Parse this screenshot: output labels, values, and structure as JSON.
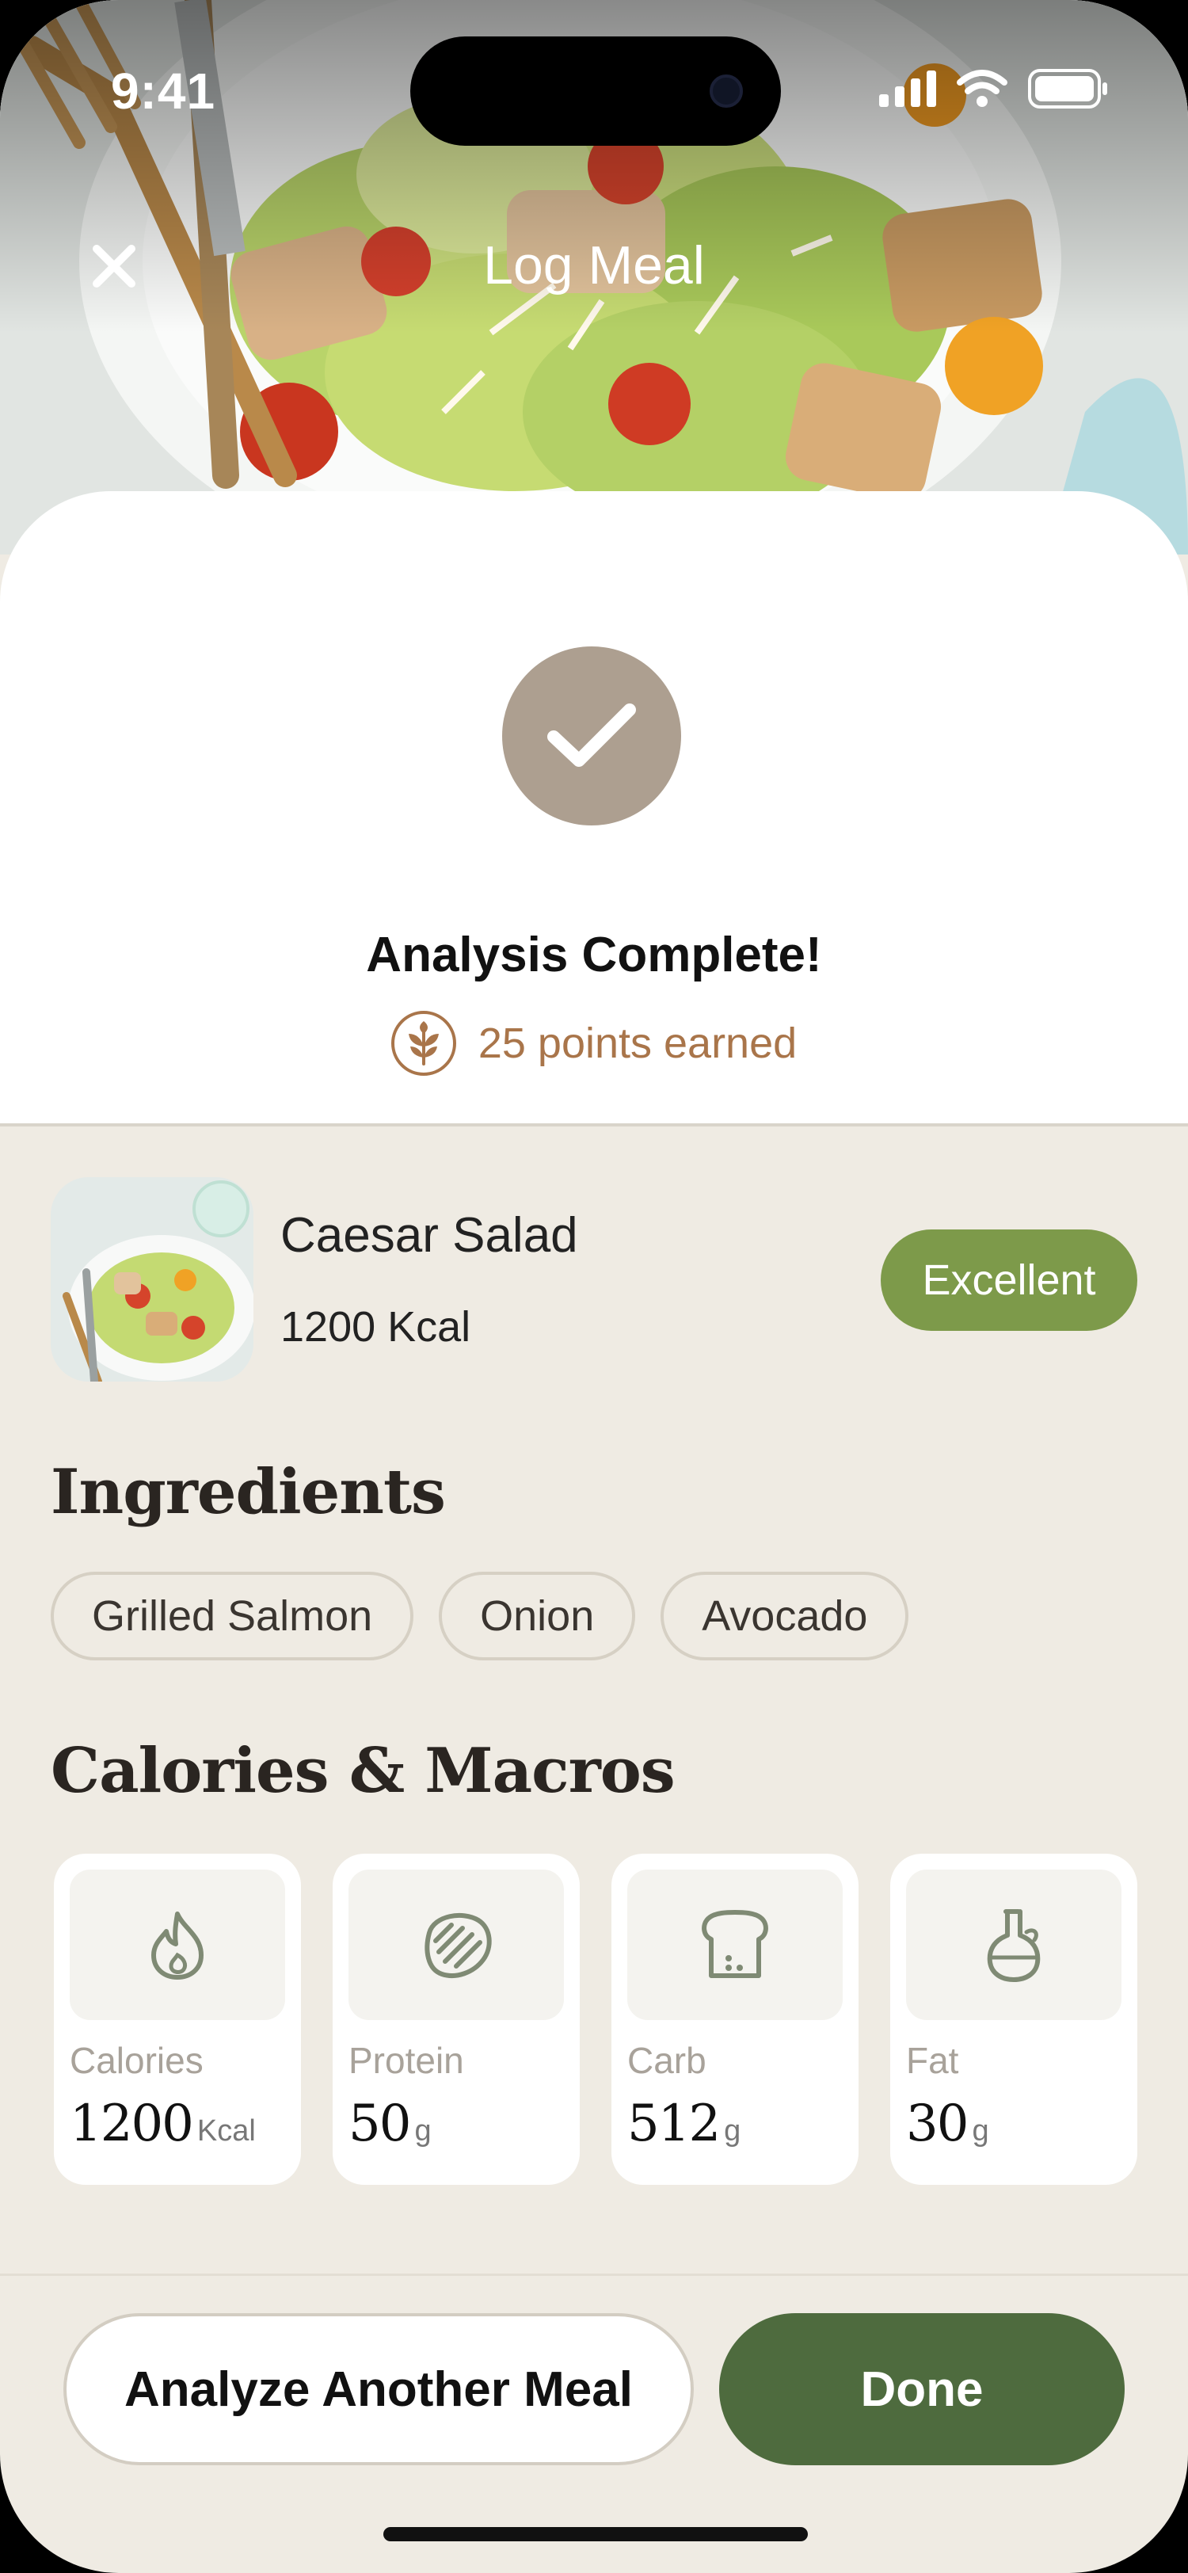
{
  "status_bar": {
    "time": "9:41"
  },
  "nav": {
    "title": "Log Meal"
  },
  "analysis": {
    "title": "Analysis Complete!",
    "points_text": "25 points earned"
  },
  "meal": {
    "name": "Caesar Salad",
    "kcal": "1200 Kcal",
    "rating": "Excellent"
  },
  "ingredients": {
    "title": "Ingredients",
    "items": [
      "Grilled Salmon",
      "Onion",
      "Avocado"
    ]
  },
  "macros": {
    "title": "Calories & Macros",
    "items": [
      {
        "label": "Calories",
        "value": "1200",
        "unit": "Kcal",
        "icon": "flame-icon"
      },
      {
        "label": "Protein",
        "value": "50",
        "unit": "g",
        "icon": "steak-icon"
      },
      {
        "label": "Carb",
        "value": "512",
        "unit": "g",
        "icon": "bread-icon"
      },
      {
        "label": "Fat",
        "value": "30",
        "unit": "g",
        "icon": "oil-bottle-icon"
      }
    ]
  },
  "actions": {
    "secondary": "Analyze Another Meal",
    "primary": "Done"
  },
  "colors": {
    "background": "#efebe3",
    "accent_green": "#4e6b3e",
    "rating_green": "#7d9a4a",
    "points_brown": "#a9754a",
    "check_circle": "#ad9f90"
  }
}
